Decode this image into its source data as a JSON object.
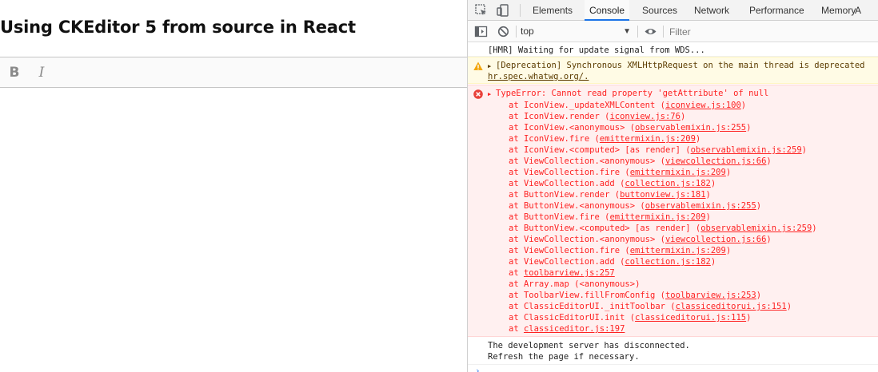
{
  "app": {
    "title": "Using CKEditor 5 from source in React",
    "toolbar": {
      "bold_label": "B",
      "italic_label": "I"
    }
  },
  "devtools": {
    "tabs": [
      "Elements",
      "Console",
      "Sources",
      "Network",
      "Performance",
      "Memory",
      "A"
    ],
    "active_tab": "Console",
    "context": "top",
    "filter_placeholder": "Filter",
    "accent_color": "#1a73e8",
    "icons": [
      "inspect-element-icon",
      "device-toolbar-icon",
      "sidebar-toggle-icon",
      "clear-console-icon",
      "eye-icon"
    ]
  },
  "console": {
    "log_line": "[HMR] Waiting for update signal from WDS...",
    "warning": {
      "line1": "[Deprecation] Synchronous XMLHttpRequest on the main thread is deprecated",
      "line2": "hr.spec.whatwg.org/."
    },
    "error": {
      "header": "TypeError: Cannot read property 'getAttribute' of null",
      "frames": [
        {
          "fn": "IconView._updateXMLContent",
          "loc": "iconview.js:100"
        },
        {
          "fn": "IconView.render",
          "loc": "iconview.js:76"
        },
        {
          "fn": "IconView.<anonymous>",
          "loc": "observablemixin.js:255"
        },
        {
          "fn": "IconView.fire",
          "loc": "emittermixin.js:209"
        },
        {
          "fn": "IconView.<computed> [as render]",
          "loc": "observablemixin.js:259"
        },
        {
          "fn": "ViewCollection.<anonymous>",
          "loc": "viewcollection.js:66"
        },
        {
          "fn": "ViewCollection.fire",
          "loc": "emittermixin.js:209"
        },
        {
          "fn": "ViewCollection.add",
          "loc": "collection.js:182"
        },
        {
          "fn": "ButtonView.render",
          "loc": "buttonview.js:181"
        },
        {
          "fn": "ButtonView.<anonymous>",
          "loc": "observablemixin.js:255"
        },
        {
          "fn": "ButtonView.fire",
          "loc": "emittermixin.js:209"
        },
        {
          "fn": "ButtonView.<computed> [as render]",
          "loc": "observablemixin.js:259"
        },
        {
          "fn": "ViewCollection.<anonymous>",
          "loc": "viewcollection.js:66"
        },
        {
          "fn": "ViewCollection.fire",
          "loc": "emittermixin.js:209"
        },
        {
          "fn": "ViewCollection.add",
          "loc": "collection.js:182"
        },
        {
          "fn": "",
          "loc": "toolbarview.js:257"
        },
        {
          "fn": "Array.map",
          "loc": "<anonymous>",
          "plain": true
        },
        {
          "fn": "ToolbarView.fillFromConfig",
          "loc": "toolbarview.js:253"
        },
        {
          "fn": "ClassicEditorUI._initToolbar",
          "loc": "classiceditorui.js:151"
        },
        {
          "fn": "ClassicEditorUI.init",
          "loc": "classiceditorui.js:115"
        },
        {
          "fn": "",
          "loc": "classiceditor.js:197"
        }
      ]
    },
    "info": {
      "line1": "The development server has disconnected.",
      "line2": "Refresh the page if necessary."
    },
    "prompt": "›"
  }
}
